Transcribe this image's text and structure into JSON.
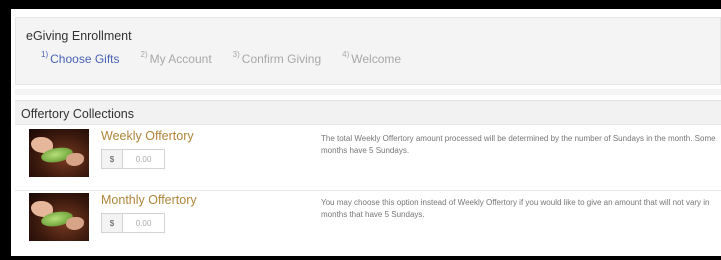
{
  "enrollment": {
    "title": "eGiving Enrollment",
    "steps": [
      {
        "num": "1)",
        "label": "Choose Gifts",
        "active": true
      },
      {
        "num": "2)",
        "label": "My Account",
        "active": false
      },
      {
        "num": "3)",
        "label": "Confirm Giving",
        "active": false
      },
      {
        "num": "4)",
        "label": "Welcome",
        "active": false
      }
    ]
  },
  "section": {
    "title": "Offertory Collections"
  },
  "offerings": [
    {
      "title": "Weekly Offertory",
      "currency": "$",
      "amount_placeholder": "0.00",
      "description": "The total Weekly Offertory amount processed will be determined by the number of Sundays in the month. Some months have 5 Sundays."
    },
    {
      "title": "Monthly Offertory",
      "currency": "$",
      "amount_placeholder": "0.00",
      "description": "You may choose this option instead of Weekly Offertory if you would like to give an amount that will not vary in months that have 5 Sundays."
    }
  ],
  "colors": {
    "active_step": "#4a62b6",
    "inactive_step": "#a8a8a8",
    "offering_title": "#b0863a"
  }
}
